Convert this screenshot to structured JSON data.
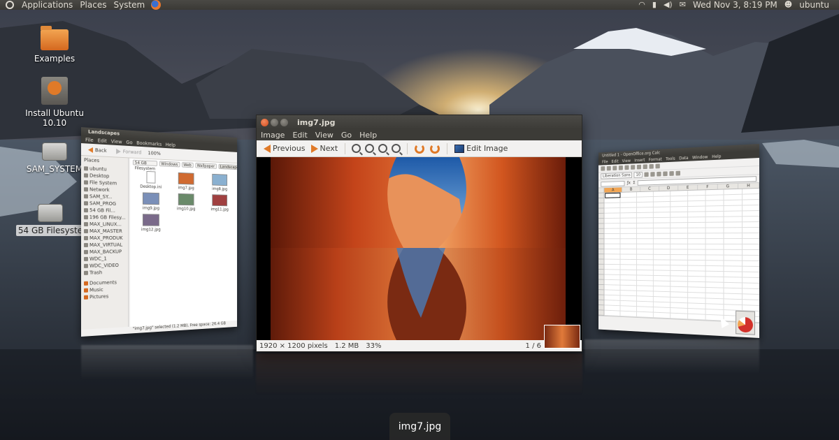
{
  "top_panel": {
    "menus": [
      "Applications",
      "Places",
      "System"
    ],
    "clock": "Wed Nov  3,  8:19 PM",
    "user": "ubuntu",
    "icons": [
      "ubuntu-logo-icon",
      "firefox-icon",
      "network-icon",
      "battery-icon",
      "volume-icon",
      "mail-icon",
      "user-icon"
    ]
  },
  "desktop": {
    "icons": [
      {
        "label": "Examples",
        "icon": "folder-icon"
      },
      {
        "label": "Install Ubuntu 10.10",
        "icon": "installer-icon"
      },
      {
        "label": "SAM_SYSTEM",
        "icon": "drive-icon"
      },
      {
        "label": "54 GB Filesyste",
        "icon": "drive-icon"
      }
    ]
  },
  "viewer": {
    "title": "img7.jpg",
    "menu": [
      "Image",
      "Edit",
      "View",
      "Go",
      "Help"
    ],
    "toolbar": {
      "previous": "Previous",
      "next": "Next",
      "edit_image": "Edit Image"
    },
    "status": {
      "dimensions": "1920 × 1200 pixels",
      "size": "1.2 MB",
      "zoom": "33%",
      "pager": "1 / 6"
    },
    "accent": "#e07a28"
  },
  "files": {
    "title": "Landscapes",
    "menu": [
      "File",
      "Edit",
      "View",
      "Go",
      "Bookmarks",
      "Help"
    ],
    "toolbar": {
      "back": "Back",
      "forward": "Forward",
      "zoom": "100%"
    },
    "path": [
      "54 GB Filesystem",
      "Windows",
      "Web",
      "Wallpaper",
      "Landscapes"
    ],
    "places_header": "Places",
    "places": [
      "ubuntu",
      "Desktop",
      "File System",
      "Network",
      "SAM_SY...",
      "SAM_PROG",
      "54 GB Fil...",
      "196 GB Filesy...",
      "MAX_LINUX...",
      "MAX_MASTER",
      "MAX_PRODUK",
      "MAX_VIRTUAL",
      "MAX_BACKUP",
      "WDC_1",
      "WDC_VIDEO",
      "Trash"
    ],
    "bookmarks": [
      "Documents",
      "Music",
      "Pictures"
    ],
    "files": [
      "Desktop.ini",
      "img7.jpg",
      "img8.jpg",
      "img9.jpg",
      "img10.jpg",
      "img11.jpg",
      "img12.jpg"
    ],
    "status": "\"img7.jpg\" selected (1.2 MB), Free space: 26.4 GB"
  },
  "calc": {
    "title": "Untitled 1 - OpenOffice.org Calc",
    "menu": [
      "File",
      "Edit",
      "View",
      "Insert",
      "Format",
      "Tools",
      "Data",
      "Window",
      "Help"
    ],
    "font": "Liberation Sans",
    "font_size": "10",
    "columns": [
      "A",
      "B",
      "C",
      "D",
      "E",
      "F",
      "G",
      "H"
    ]
  },
  "switcher": {
    "label": "img7.jpg"
  }
}
